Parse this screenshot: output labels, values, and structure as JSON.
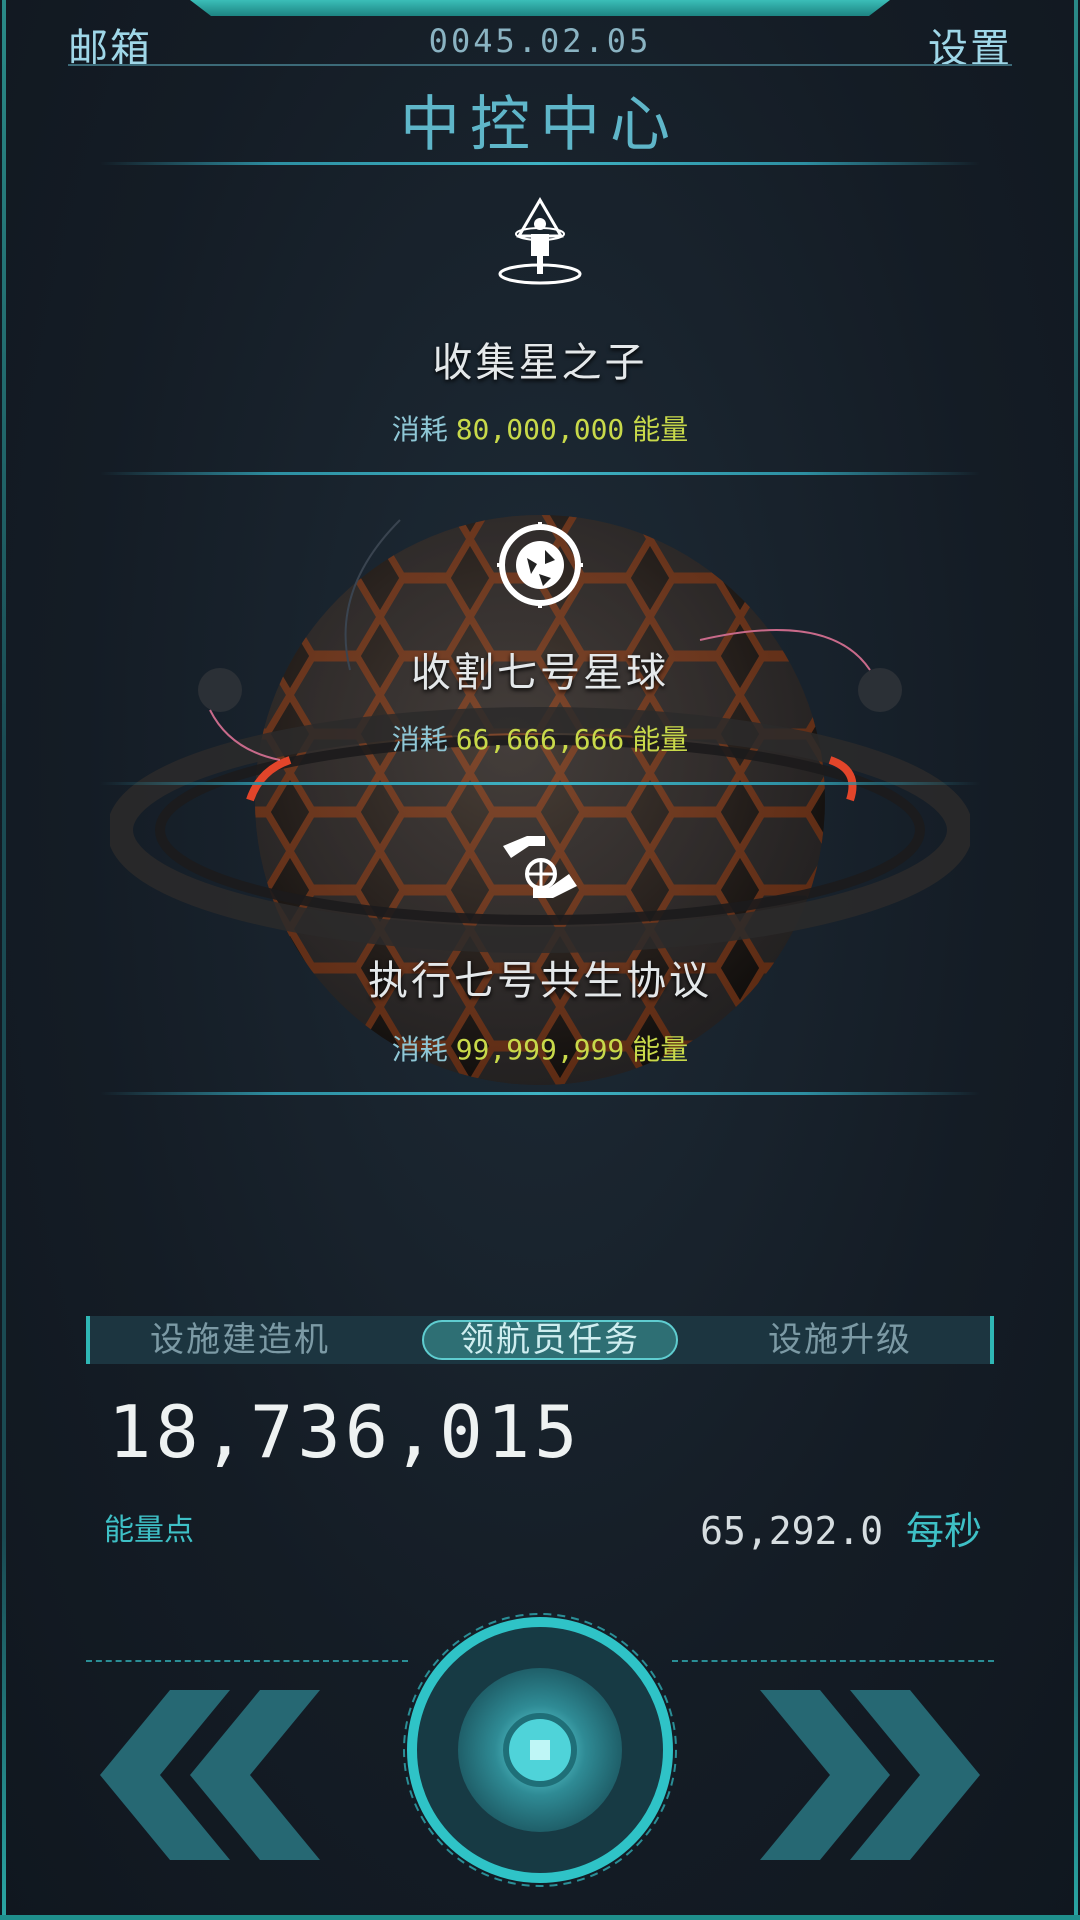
{
  "header": {
    "mail_label": "邮箱",
    "date": "0045.02.05",
    "settings_label": "设置",
    "title": "中控中心"
  },
  "missions": [
    {
      "icon": "cosmic-figure-icon",
      "name": "收集星之子",
      "cost_label": "消耗",
      "cost_value": "80,000,000",
      "cost_unit": "能量"
    },
    {
      "icon": "mech-planet-icon",
      "name": "收割七号星球",
      "cost_label": "消耗",
      "cost_value": "66,666,666",
      "cost_unit": "能量"
    },
    {
      "icon": "hand-globe-icon",
      "name": "执行七号共生协议",
      "cost_label": "消耗",
      "cost_value": "99,999,999",
      "cost_unit": "能量"
    }
  ],
  "tabs": [
    {
      "label": "设施建造机",
      "active": false
    },
    {
      "label": "领航员任务",
      "active": true
    },
    {
      "label": "设施升级",
      "active": false
    }
  ],
  "energy": {
    "value": "18,736,015",
    "label": "能量点",
    "rate_value": "65,292.0",
    "rate_unit": "每秒"
  },
  "colors": {
    "accent": "#3ec0c6",
    "cost": "#c8d94a",
    "title": "#5fb6c9"
  }
}
